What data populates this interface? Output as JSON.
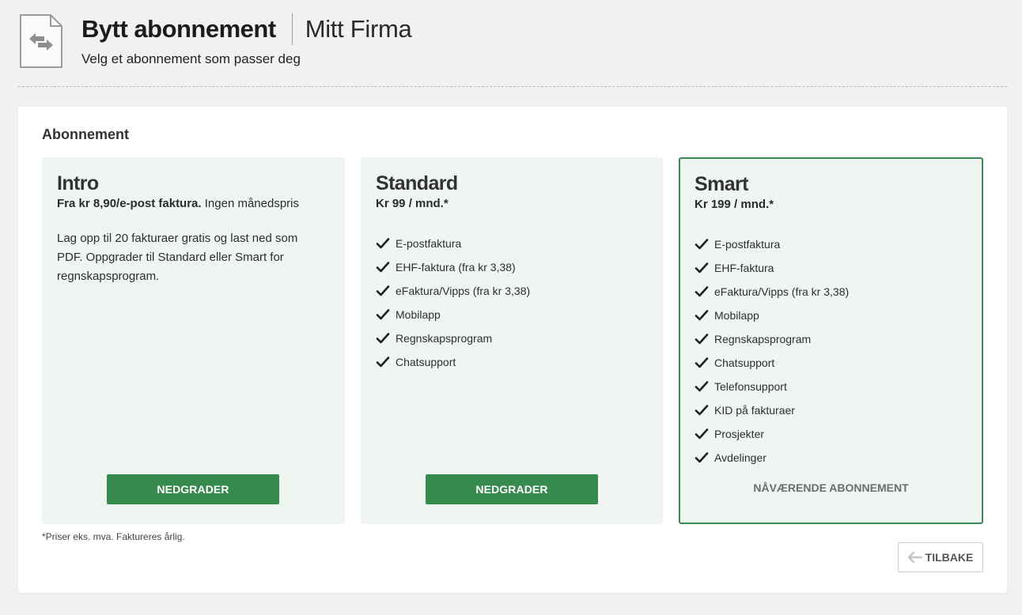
{
  "header": {
    "title": "Bytt abonnement",
    "company": "Mitt Firma",
    "subtitle": "Velg et abonnement som passer deg",
    "icon": "swap-document-icon"
  },
  "panel": {
    "title": "Abonnement"
  },
  "plans": [
    {
      "name": "Intro",
      "price_bold": "Fra kr 8,90/e-post faktura.",
      "price_rest": " Ingen månedspris",
      "description": "Lag opp til 20 fakturaer gratis og last ned som PDF. Oppgrader til Standard eller Smart for regnskapsprogram.",
      "action_label": "NEDGRADER"
    },
    {
      "name": "Standard",
      "price_bold": "Kr 99 / mnd.*",
      "features": [
        "E-postfaktura",
        "EHF-faktura (fra kr 3,38)",
        "eFaktura/Vipps (fra kr 3,38)",
        "Mobilapp",
        "Regnskapsprogram",
        "Chatsupport"
      ],
      "action_label": "NEDGRADER"
    },
    {
      "name": "Smart",
      "price_bold": "Kr 199 / mnd.*",
      "features": [
        "E-postfaktura",
        "EHF-faktura",
        "eFaktura/Vipps (fra kr 3,38)",
        "Mobilapp",
        "Regnskapsprogram",
        "Chatsupport",
        "Telefonsupport",
        "KID på fakturaer",
        "Prosjekter",
        "Avdelinger"
      ],
      "current_label": "NÅVÆRENDE ABONNEMENT"
    }
  ],
  "footnote": "*Priser eks. mva. Faktureres årlig.",
  "back_button": {
    "label": "TILBAKE",
    "icon": "arrow-left-icon"
  },
  "colors": {
    "accent": "#378a4d",
    "card_bg": "#eff5f1",
    "page_bg": "#f0f1f2"
  }
}
